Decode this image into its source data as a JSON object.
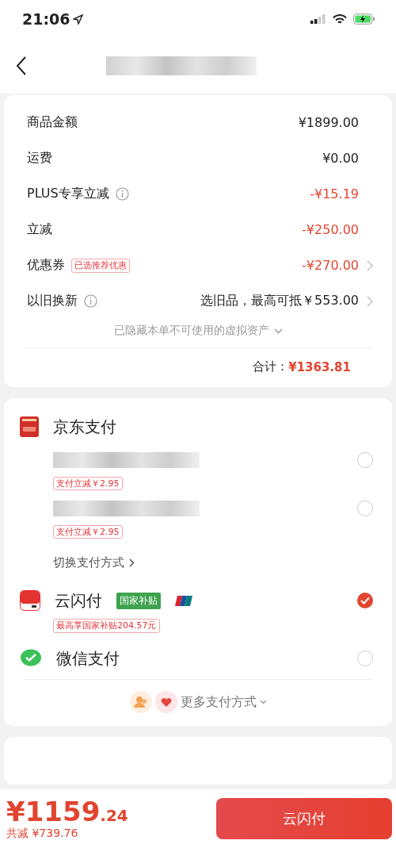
{
  "status_bar": {
    "time": "21:06"
  },
  "summary": {
    "rows": [
      {
        "label": "商品金额",
        "value": "¥1899.00",
        "highlight": false,
        "link": false
      },
      {
        "label": "运费",
        "value": "¥0.00",
        "highlight": false,
        "link": false
      },
      {
        "label": "PLUS专享立减",
        "info": true,
        "value": "-¥15.19",
        "highlight": true,
        "link": false
      },
      {
        "label": "立减",
        "value": "-¥250.00",
        "highlight": true,
        "link": false
      },
      {
        "label": "优惠券",
        "tag": "已选推荐优惠",
        "value": "-¥270.00",
        "highlight": true,
        "link": true
      },
      {
        "label": "以旧换新",
        "info": true,
        "value": "选旧品，最高可抵￥553.00",
        "highlight": false,
        "link": true
      }
    ],
    "hidden_note": "已隐藏本单不可使用的虚拟资产",
    "total_label": "合计：",
    "total_value": "¥1363.81"
  },
  "payment": {
    "jd": {
      "title": "京东支付",
      "cards": [
        {
          "tag": "支付立减￥2.95",
          "selected": false
        },
        {
          "tag": "支付立减￥2.95",
          "selected": false
        }
      ],
      "switch_label": "切换支付方式"
    },
    "methods": [
      {
        "kind": "unionpay",
        "name": "云闪付",
        "badge": "国家补贴",
        "tag": "最高享国家补贴204.57元",
        "selected": true
      },
      {
        "kind": "wechat",
        "name": "微信支付",
        "selected": false
      }
    ],
    "more": "更多支付方式"
  },
  "footer": {
    "price_main": "¥1159",
    "price_decimal": ".24",
    "saved": "共减 ¥739.76",
    "pay_button": "云闪付"
  }
}
